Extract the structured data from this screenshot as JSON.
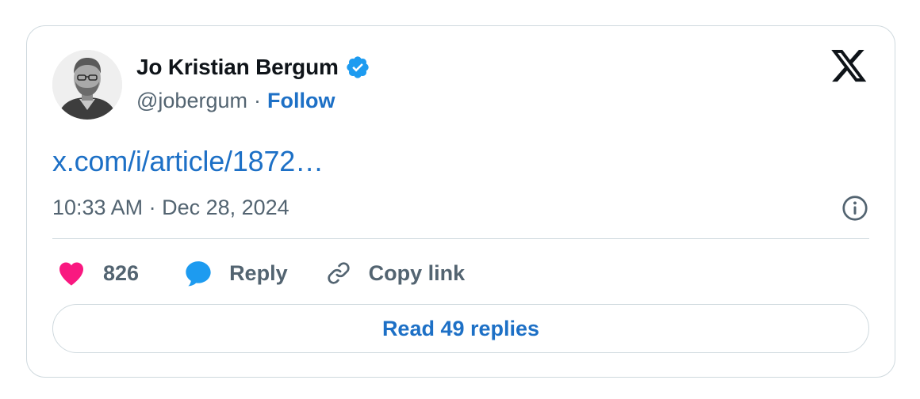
{
  "author": {
    "display_name": "Jo Kristian Bergum",
    "handle": "@jobergum",
    "separator": "·",
    "follow_label": "Follow",
    "verified_color": "#1d9bf0"
  },
  "tweet": {
    "link_text": "x.com/i/article/1872…",
    "timestamp": "10:33 AM · Dec 28, 2024"
  },
  "actions": {
    "like_count": "826",
    "reply_label": "Reply",
    "copy_link_label": "Copy link",
    "like_color": "#f91880",
    "reply_color": "#1d9bf0"
  },
  "footer": {
    "read_replies_label": "Read 49 replies"
  },
  "icons": {
    "brand": "x-logo-icon",
    "info": "info-icon",
    "like": "heart-icon",
    "reply": "speech-bubble-icon",
    "copy": "link-icon",
    "verified": "verified-badge-icon"
  }
}
